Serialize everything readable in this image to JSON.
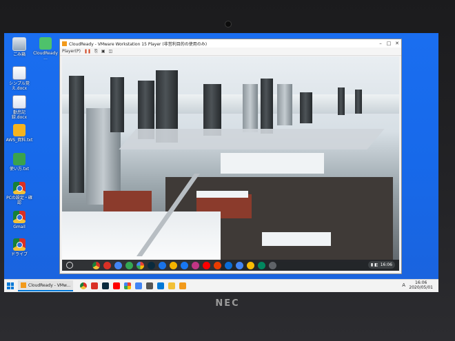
{
  "desktop": {
    "icons": [
      {
        "label": "ごみ箱",
        "icon": "recycle-bin-icon"
      },
      {
        "label": "CloudReady ...",
        "icon": "download-folder-icon"
      },
      {
        "label": "シンプル覚え.docx",
        "icon": "word-document-icon"
      },
      {
        "label": "勤怠記録.docx",
        "icon": "word-document-icon"
      },
      {
        "label": "AWS_資料.txt",
        "icon": "text-file-icon"
      },
      {
        "label": "使い方.txt",
        "icon": "shortcut-icon"
      },
      {
        "label": "PCの設定・確認",
        "icon": "chrome-icon"
      },
      {
        "label": "Gmail",
        "icon": "chrome-icon"
      },
      {
        "label": "ドライブ",
        "icon": "chrome-icon"
      }
    ]
  },
  "vmware": {
    "title": "CloudReady - VMware Workstation 15 Player (非営利目的の使用のみ)",
    "menu_label": "Player(P)",
    "guest": {
      "clock": "16:06",
      "shelf_apps": [
        "chrome-icon",
        "gmail-icon",
        "translate-icon",
        "maps-icon",
        "photos-icon",
        "lightroom-icon",
        "camera-icon",
        "slides-icon",
        "facebook-icon",
        "instagram-icon",
        "youtube-icon",
        "office-icon",
        "onedrive-icon",
        "files-icon",
        "keep-icon",
        "play-store-icon",
        "settings-icon"
      ]
    }
  },
  "taskbar": {
    "active_app_label": "CloudReady - VMw...",
    "pinned": [
      "chrome-icon",
      "gmail-icon",
      "lightroom-icon",
      "youtube-icon",
      "photos-icon",
      "files-icon",
      "calculator-icon",
      "store-icon",
      "explorer-icon",
      "vmware-icon"
    ],
    "ime": "A",
    "time": "16:06",
    "date": "2020/05/01"
  },
  "bezel": {
    "brand": "NEC"
  },
  "colors": {
    "desktop_blue": "#1769ea",
    "taskbar": "#f3f3f3",
    "accent": "#0078d7"
  }
}
